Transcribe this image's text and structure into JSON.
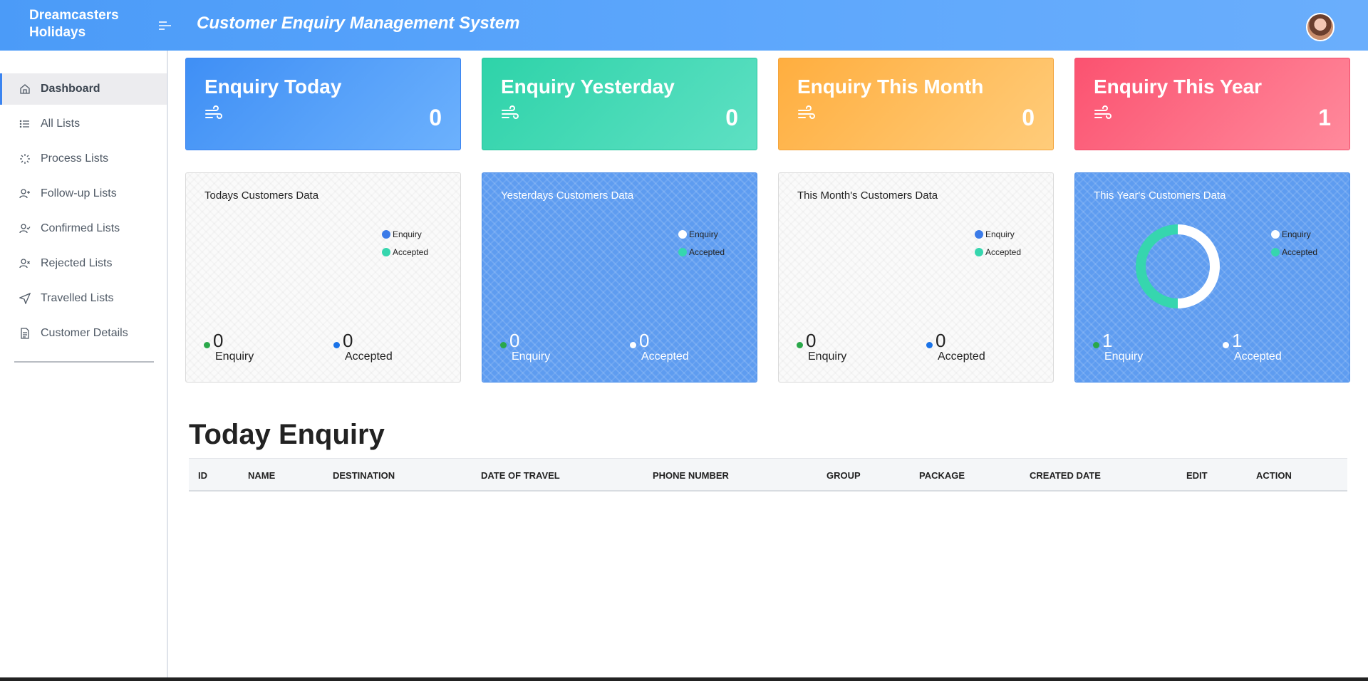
{
  "header": {
    "brand": "Dreamcasters Holidays",
    "title": "Customer Enquiry Management System"
  },
  "sidebar": {
    "items": [
      {
        "label": "Dashboard",
        "icon": "home-icon",
        "active": true
      },
      {
        "label": "All Lists",
        "icon": "list-icon"
      },
      {
        "label": "Process Lists",
        "icon": "loader-icon"
      },
      {
        "label": "Follow-up Lists",
        "icon": "user-plus-icon"
      },
      {
        "label": "Confirmed Lists",
        "icon": "user-check-icon"
      },
      {
        "label": "Rejected Lists",
        "icon": "user-x-icon"
      },
      {
        "label": "Travelled Lists",
        "icon": "send-icon"
      },
      {
        "label": "Customer Details",
        "icon": "file-text-icon"
      }
    ]
  },
  "stat_cards": [
    {
      "title": "Enquiry Today",
      "value": "0",
      "icon": "wind-icon",
      "color": "#4a96f7"
    },
    {
      "title": "Enquiry Yesterday",
      "value": "0",
      "icon": "wind-icon",
      "color": "#36d6ae"
    },
    {
      "title": "Enquiry This Month",
      "value": "0",
      "icon": "wind-icon",
      "color": "#ffb74d"
    },
    {
      "title": "Enquiry This Year",
      "value": "1",
      "icon": "wind-icon",
      "color": "#fb5d78"
    }
  ],
  "data_cards": [
    {
      "title": "Todays Customers Data",
      "theme": "light",
      "legend": [
        "Enquiry",
        "Accepted"
      ],
      "enquiry": "0",
      "accepted": "0",
      "enquiry_label": "Enquiry",
      "accepted_label": "Accepted"
    },
    {
      "title": "Yesterdays Customers Data",
      "theme": "blue",
      "legend": [
        "Enquiry",
        "Accepted"
      ],
      "enquiry": "0",
      "accepted": "0",
      "enquiry_label": "Enquiry",
      "accepted_label": "Accepted"
    },
    {
      "title": "This Month's Customers Data",
      "theme": "light",
      "legend": [
        "Enquiry",
        "Accepted"
      ],
      "enquiry": "0",
      "accepted": "0",
      "enquiry_label": "Enquiry",
      "accepted_label": "Accepted"
    },
    {
      "title": "This Year's Customers Data",
      "theme": "blue",
      "legend": [
        "Enquiry",
        "Accepted"
      ],
      "enquiry": "1",
      "accepted": "1",
      "enquiry_label": "Enquiry",
      "accepted_label": "Accepted"
    }
  ],
  "chart_data": {
    "type": "pie",
    "title": "This Year's Customers Data",
    "categories": [
      "Enquiry",
      "Accepted"
    ],
    "values": [
      1,
      1
    ],
    "colors": [
      "#ffffff",
      "#36d6ae"
    ]
  },
  "colors": {
    "enquiry_dot_light": "#3b7be8",
    "accepted_dot": "#36d6ae",
    "enquiry_dot_blue_theme": "#ffffff",
    "green_dot": "#2aa84a"
  },
  "table": {
    "title": "Today Enquiry",
    "columns": [
      "ID",
      "NAME",
      "DESTINATION",
      "DATE OF TRAVEL",
      "PHONE NUMBER",
      "GROUP",
      "PACKAGE",
      "CREATED DATE",
      "EDIT",
      "ACTION"
    ],
    "rows": []
  }
}
